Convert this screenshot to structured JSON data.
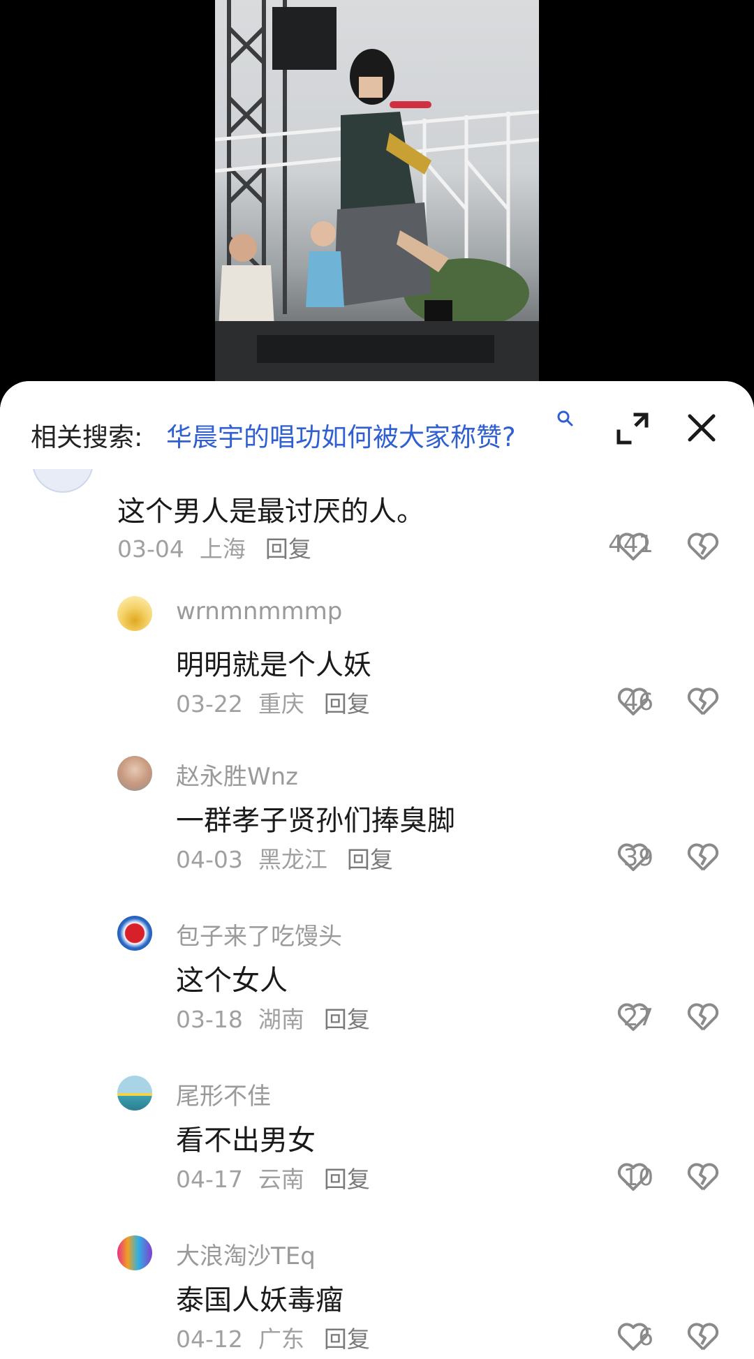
{
  "related_search": {
    "label": "相关搜索:",
    "query": "华晨宇的唱功如何被大家称赞?"
  },
  "top_comment": {
    "text": "这个男人是最讨厌的人。",
    "date": "03-04",
    "location": "上海",
    "reply_label": "回复",
    "likes": "441"
  },
  "replies": [
    {
      "username": "wrnmnmmmp",
      "text": "明明就是个人妖",
      "date": "03-22",
      "location": "重庆",
      "reply_label": "回复",
      "likes": "46"
    },
    {
      "username": "赵永胜Wnz",
      "text": "一群孝子贤孙们捧臭脚",
      "date": "04-03",
      "location": "黑龙江",
      "reply_label": "回复",
      "likes": "39"
    },
    {
      "username": "包子来了吃馒头",
      "text": "这个女人",
      "date": "03-18",
      "location": "湖南",
      "reply_label": "回复",
      "likes": "27"
    },
    {
      "username": "尾形不佳",
      "text": "看不出男女",
      "date": "04-17",
      "location": "云南",
      "reply_label": "回复",
      "likes": "10"
    },
    {
      "username": "大浪淘沙TEq",
      "text": "泰国人妖毒瘤",
      "date": "04-12",
      "location": "广东",
      "reply_label": "回复",
      "likes": "6"
    }
  ],
  "icons": {
    "search": "search-icon",
    "expand": "expand-icon",
    "close": "close-icon",
    "like": "heart-icon",
    "dislike": "broken-heart-icon"
  },
  "colors": {
    "link": "#2f5fd0",
    "meta": "#a0a0a0",
    "text": "#1a1a1a"
  }
}
